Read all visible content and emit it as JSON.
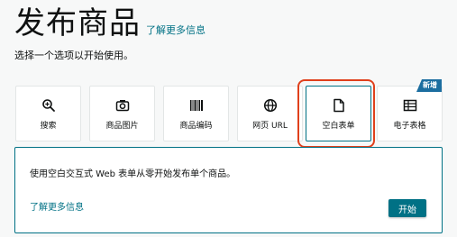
{
  "header": {
    "title": "发布商品",
    "learn_more": "了解更多信息"
  },
  "subtitle": "选择一个选项以开始使用。",
  "options": [
    {
      "label": "搜索",
      "icon": "search-icon"
    },
    {
      "label": "商品图片",
      "icon": "camera-icon"
    },
    {
      "label": "商品编码",
      "icon": "barcode-icon"
    },
    {
      "label": "网页 URL",
      "icon": "globe-icon"
    },
    {
      "label": "空白表单",
      "icon": "document-icon",
      "selected": true
    },
    {
      "label": "电子表格",
      "icon": "spreadsheet-icon",
      "badge": "新增"
    }
  ],
  "detail": {
    "description": "使用空白交互式 Web 表单从零开始发布单个商品。",
    "learn_more": "了解更多信息",
    "start_label": "开始"
  },
  "colors": {
    "accent": "#007185",
    "selection_ring": "#e0401c",
    "badge": "#1c6ea0"
  }
}
